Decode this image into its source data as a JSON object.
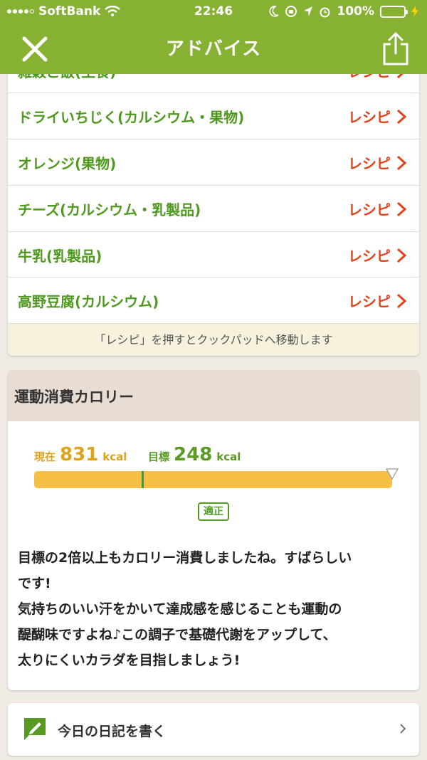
{
  "status_bar": {
    "carrier": "SoftBank",
    "time": "22:46",
    "battery_percent": "100%",
    "icons": [
      "signal-icon",
      "wifi-icon",
      "moon-icon",
      "lock-rotation-icon",
      "location-icon",
      "alarm-icon",
      "battery-icon",
      "charging-icon"
    ]
  },
  "nav": {
    "title": "アドバイス",
    "close_icon": "close-icon",
    "share_icon": "share-icon"
  },
  "recipes": {
    "items": [
      {
        "name": "雑穀ご飯(主食)",
        "action": "レシピ"
      },
      {
        "name": "ドライいちじく(カルシウム・果物)",
        "action": "レシピ"
      },
      {
        "name": "オレンジ(果物)",
        "action": "レシピ"
      },
      {
        "name": "チーズ(カルシウム・乳製品)",
        "action": "レシピ"
      },
      {
        "name": "牛乳(乳製品)",
        "action": "レシピ"
      },
      {
        "name": "高野豆腐(カルシウム)",
        "action": "レシピ"
      }
    ],
    "note": "「レシピ」を押すとクックパッドへ移動します"
  },
  "calorie": {
    "heading": "運動消費カロリー",
    "current_label": "現在",
    "current_value": "831",
    "current_unit": "kcal",
    "target_label": "目標",
    "target_value": "248",
    "target_unit": "kcal",
    "target_marker_fraction": 0.3,
    "status_badge": "適正",
    "advice_lines": [
      "目標の2倍以上もカロリー消費しましたね。すばらしい",
      "です!",
      "気持ちのいい汗をかいて達成感を感じることも運動の",
      "醍醐味ですよね♪この調子で基礎代謝をアップして、",
      "太りにくいカラダを目指しましょう!"
    ]
  },
  "diary": {
    "label": "今日の日記を書く",
    "icon": "pen-icon"
  },
  "colors": {
    "header_green": "#86b132",
    "food_green": "#4f9a1e",
    "recipe_red": "#e0441a",
    "bar_orange": "#f6c044",
    "current_orange": "#e0a21c"
  }
}
